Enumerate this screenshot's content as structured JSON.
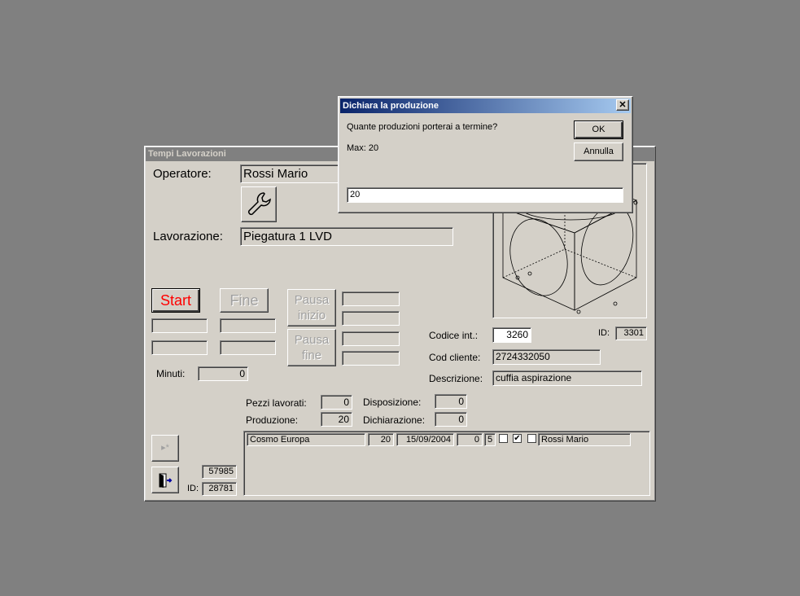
{
  "main_window": {
    "title": "Tempi Lavorazioni",
    "operatore_label": "Operatore:",
    "operatore_value": "Rossi Mario",
    "lavorazione_label": "Lavorazione:",
    "lavorazione_value": "Piegatura 1 LVD",
    "start_label": "Start",
    "fine_label": "Fine",
    "pausa_inizio_label_1": "Pausa",
    "pausa_inizio_label_2": "inizio",
    "pausa_fine_label_1": "Pausa",
    "pausa_fine_label_2": "fine",
    "minuti_label": "Minuti:",
    "minuti_value": "0",
    "codice_int_label": "Codice  int.:",
    "codice_int_value": "3260",
    "id_label": "ID:",
    "id_value": "3301",
    "cod_cliente_label": "Cod cliente:",
    "cod_cliente_value": "2724332050",
    "descrizione_label": "Descrizione:",
    "descrizione_value": "cuffia aspirazione",
    "pezzi_lavorati_label": "Pezzi lavorati:",
    "pezzi_lavorati_value": "0",
    "disposizione_label": "Disposizione:",
    "disposizione_value": "0",
    "produzione_label": "Produzione:",
    "produzione_value": "20",
    "dichiarazione_label": "Dichiarazione:",
    "dichiarazione_value": "0",
    "record_num": "57985",
    "bottom_id_label": "ID:",
    "bottom_id_value": "28781",
    "row": {
      "cliente": "Cosmo Europa",
      "qty": "20",
      "data": "15/09/2004",
      "val": "0",
      "n": "5",
      "check1": false,
      "check2": true,
      "check3": false,
      "operatore": "Rossi Mario"
    },
    "icons": {
      "tool": "wrench-icon",
      "new_record": "new-record-icon",
      "exit": "exit-door-icon"
    }
  },
  "dialog": {
    "title": "Dichiara la produzione",
    "question": "Quante produzioni porterai a termine?",
    "max_text": "Max: 20",
    "ok_label": "OK",
    "annulla_label": "Annulla",
    "input_value": "20"
  }
}
